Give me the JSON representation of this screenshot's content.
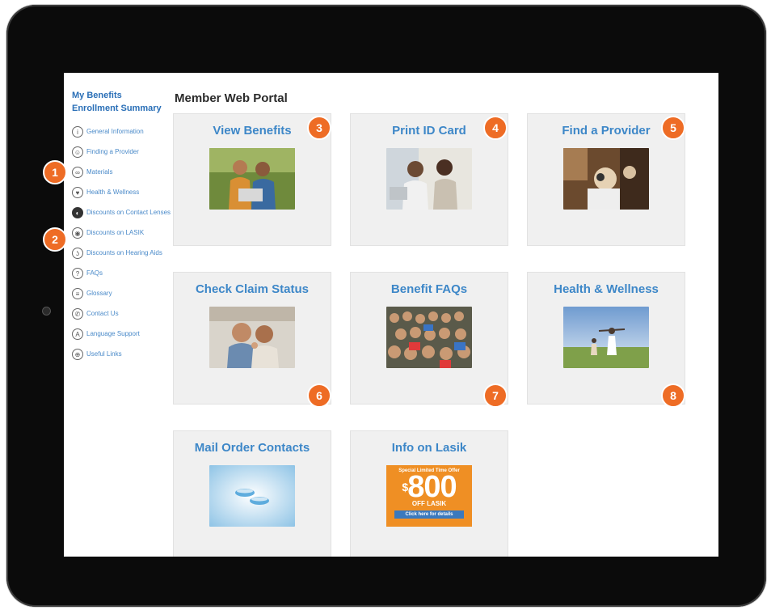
{
  "sidebar": {
    "my_benefits": "My Benefits",
    "enrollment_summary": "Enrollment Summary",
    "items": [
      {
        "label": "General Information",
        "icon": "info-circle-icon",
        "glyph": "i"
      },
      {
        "label": "Finding a Provider",
        "icon": "person-search-icon",
        "glyph": "☺"
      },
      {
        "label": "Materials",
        "icon": "glasses-icon",
        "glyph": "∞"
      },
      {
        "label": "Health & Wellness",
        "icon": "heart-icon",
        "glyph": "♥"
      },
      {
        "label": "Discounts on Contact Lenses",
        "icon": "contact-lens-icon",
        "glyph": "◐"
      },
      {
        "label": "Discounts on LASIK",
        "icon": "eye-icon",
        "glyph": "◉"
      },
      {
        "label": "Discounts on Hearing Aids",
        "icon": "ear-icon",
        "glyph": "ʖ"
      },
      {
        "label": "FAQs",
        "icon": "question-icon",
        "glyph": "?"
      },
      {
        "label": "Glossary",
        "icon": "book-icon",
        "glyph": "≡"
      },
      {
        "label": "Contact Us",
        "icon": "phone-icon",
        "glyph": "✆"
      },
      {
        "label": "Language Support",
        "icon": "language-icon",
        "glyph": "A"
      },
      {
        "label": "Useful Links",
        "icon": "link-icon",
        "glyph": "⊕"
      }
    ]
  },
  "portal_title": "Member Web Portal",
  "tiles": [
    {
      "title": "View Benefits",
      "badge": "3",
      "image": "couple-with-laptop-photo"
    },
    {
      "title": "Print ID Card",
      "badge": "4",
      "image": "couple-at-computer-photo"
    },
    {
      "title": "Find a Provider",
      "badge": "5",
      "image": "eye-exam-photo"
    },
    {
      "title": "Check Claim Status",
      "badge": "6",
      "image": "smiling-couple-photo"
    },
    {
      "title": "Benefit FAQs",
      "badge": "7",
      "image": "crowd-photo"
    },
    {
      "title": "Health & Wellness",
      "badge": "8",
      "image": "family-in-field-photo"
    },
    {
      "title": "Mail Order Contacts",
      "image": "contact-lenses-photo"
    },
    {
      "title": "Info on Lasik",
      "image": "lasik-ad-graphic"
    }
  ],
  "callouts": [
    "1",
    "2"
  ],
  "lasik_ad": {
    "headline": "Special Limited Time Offer",
    "amount": "800",
    "currency": "$",
    "off_text": "OFF LASIK",
    "button": "Click here for details"
  },
  "colors": {
    "link_blue": "#3d87c8",
    "badge_orange": "#ee6c25",
    "tile_bg": "#f0f0f0"
  }
}
